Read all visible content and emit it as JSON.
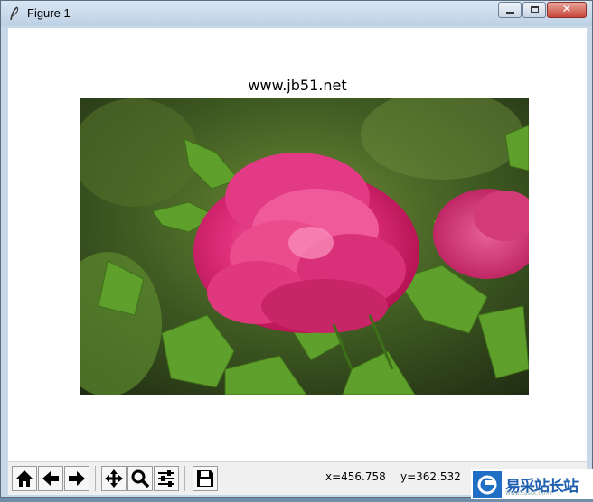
{
  "window": {
    "title": "Figure 1"
  },
  "figure": {
    "title": "www.jb51.net"
  },
  "toolbar": {
    "buttons": [
      {
        "name": "home",
        "icon": "home-icon"
      },
      {
        "name": "back",
        "icon": "arrow-left-icon"
      },
      {
        "name": "forward",
        "icon": "arrow-right-icon"
      },
      {
        "name": "pan",
        "icon": "move-icon"
      },
      {
        "name": "zoom",
        "icon": "magnifier-icon"
      },
      {
        "name": "subplots",
        "icon": "sliders-icon"
      },
      {
        "name": "save",
        "icon": "floppy-disk-icon"
      }
    ],
    "x_readout": "x=456.758",
    "y_readout": "y=362.532"
  },
  "watermark": {
    "text": "易采站长站",
    "subtext": "Www.Easck.Com"
  }
}
